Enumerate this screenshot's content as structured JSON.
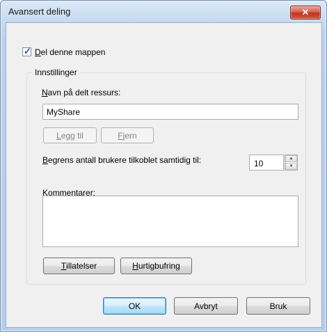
{
  "window": {
    "title": "Avansert deling",
    "close_glyph": "✕"
  },
  "share_checkbox": {
    "label_access": "D",
    "label_rest": "el denne mappen",
    "checked": true
  },
  "settings": {
    "group_label": "Innstillinger",
    "share_name_label_access": "N",
    "share_name_label_rest": "avn på delt ressurs:",
    "share_name_value": "MyShare",
    "add_button": {
      "access": "L",
      "rest": "egg til"
    },
    "remove_button": {
      "access": "F",
      "rest": "jern"
    },
    "limit_label_access": "B",
    "limit_label_rest": "egrens antall brukere tilkoblet samtidig til:",
    "limit_value": "10",
    "comments_label_access": "K",
    "comments_label_rest": "ommentarer:",
    "comments_value": "",
    "permissions_button": {
      "access": "T",
      "rest": "illatelser"
    },
    "caching_button": {
      "access": "H",
      "rest": "urtigbufring"
    }
  },
  "footer": {
    "ok": "OK",
    "cancel": "Avbryt",
    "apply": "Bruk"
  },
  "icons": {
    "spin_up": "up-arrow-icon",
    "spin_down": "down-arrow-icon",
    "check": "checkmark-icon"
  }
}
